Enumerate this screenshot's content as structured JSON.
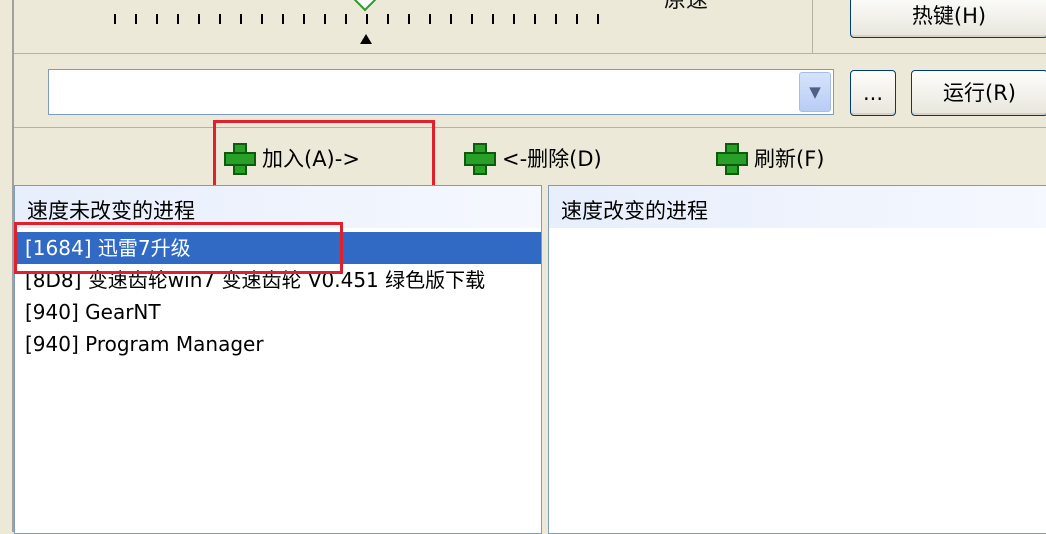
{
  "slider": {
    "speed_label": "原速"
  },
  "buttons": {
    "hotkey": "热键(H)",
    "browse": "...",
    "run": "运行(R)"
  },
  "combo": {
    "value": ""
  },
  "actions": [
    {
      "label": "加入(A)->"
    },
    {
      "label": "<-删除(D)"
    },
    {
      "label": "刷新(F)"
    }
  ],
  "left_list": {
    "header": "速度未改变的进程",
    "rows": [
      "[1684] 迅雷7升级",
      "[8D8] 变速齿轮win7 变速齿轮 V0.451 绿色版下载",
      "[940] GearNT",
      "[940] Program Manager"
    ]
  },
  "right_list": {
    "header": "速度改变的进程",
    "rows": []
  },
  "colors": {
    "selection": "#316ac5",
    "highlight": "#e0202a",
    "plus": "#28a028"
  }
}
